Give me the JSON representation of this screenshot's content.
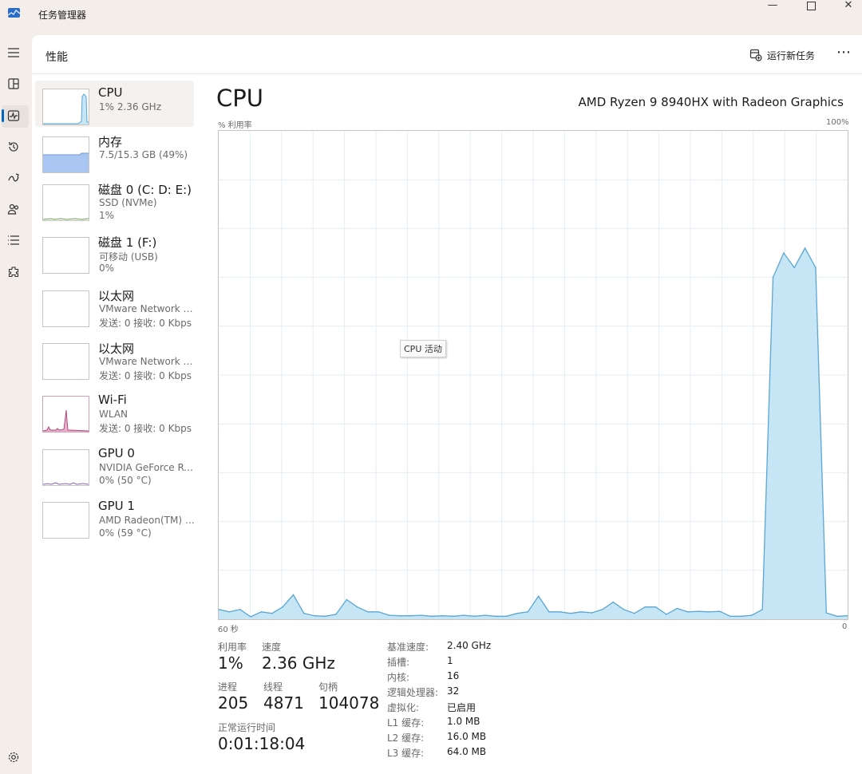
{
  "window": {
    "title": "任务管理器",
    "controls": {
      "minimize": "—",
      "close": "✕"
    }
  },
  "nav_rail": {
    "items": [
      {
        "name": "menu-icon"
      },
      {
        "name": "processes-icon"
      },
      {
        "name": "performance-icon",
        "active": true
      },
      {
        "name": "app-history-icon"
      },
      {
        "name": "startup-apps-icon"
      },
      {
        "name": "users-icon"
      },
      {
        "name": "details-icon"
      },
      {
        "name": "services-icon"
      },
      {
        "name": "settings-icon"
      }
    ]
  },
  "header": {
    "title": "性能",
    "run_new_task": "运行新任务",
    "more": "⋯"
  },
  "sidebar": {
    "items": [
      {
        "name": "CPU",
        "line2": "1%  2.36 GHz",
        "line3": ""
      },
      {
        "name": "内存",
        "line2": "7.5/15.3 GB (49%)",
        "line3": ""
      },
      {
        "name": "磁盘 0 (C: D: E:)",
        "line2": "SSD (NVMe)",
        "line3": "1%"
      },
      {
        "name": "磁盘 1 (F:)",
        "line2": "可移动 (USB)",
        "line3": "0%"
      },
      {
        "name": "以太网",
        "line2": "VMware Network A...",
        "line3": "发送: 0 接收: 0 Kbps"
      },
      {
        "name": "以太网",
        "line2": "VMware Network A...",
        "line3": "发送: 0 接收: 0 Kbps"
      },
      {
        "name": "Wi-Fi",
        "line2": "WLAN",
        "line3": "发送: 0 接收: 0 Kbps"
      },
      {
        "name": "GPU 0",
        "line2": "NVIDIA GeForce RT...",
        "line3": "0%  (50 °C)"
      },
      {
        "name": "GPU 1",
        "line2": "AMD Radeon(TM) 6...",
        "line3": "0%  (59 °C)"
      }
    ]
  },
  "detail": {
    "title": "CPU",
    "model": "AMD Ryzen 9 8940HX with Radeon Graphics",
    "y_label": "% 利用率",
    "y_max_label": "100%",
    "x_left_label": "60 秒",
    "x_right_label": "0",
    "tooltip": "CPU 活动"
  },
  "chart_data": {
    "type": "area",
    "title": "",
    "xlabel": "",
    "ylabel": "% 利用率",
    "ylim": [
      0,
      100
    ],
    "x_range_seconds": [
      60,
      0
    ],
    "grid": true,
    "color": "#5aa7d3",
    "fill": "#c6e6f6",
    "values": [
      2,
      1.5,
      2,
      0.5,
      1.5,
      1.2,
      2.5,
      5,
      1.2,
      0.7,
      0.6,
      1,
      4,
      2.5,
      1.5,
      1.5,
      0.8,
      0.7,
      0.7,
      0.8,
      0.6,
      0.7,
      0.6,
      0.8,
      0.6,
      0.8,
      0.6,
      0.6,
      1.2,
      1.5,
      4.7,
      1.5,
      1.5,
      1.2,
      1.5,
      1.3,
      2,
      3.5,
      2,
      1.2,
      2.5,
      2.5,
      1,
      2.2,
      1.5,
      1.6,
      1.5,
      1.6,
      0.6,
      0.6,
      0.8,
      2,
      70,
      75,
      72,
      76,
      72,
      1.3,
      0.6,
      0.7
    ]
  },
  "stats": {
    "utilization": {
      "label": "利用率",
      "value": "1%"
    },
    "speed": {
      "label": "速度",
      "value": "2.36 GHz"
    },
    "processes": {
      "label": "进程",
      "value": "205"
    },
    "threads": {
      "label": "线程",
      "value": "4871"
    },
    "handles": {
      "label": "句柄",
      "value": "104078"
    },
    "uptime": {
      "label": "正常运行时间",
      "value": "0:01:18:04"
    }
  },
  "specs": [
    {
      "label": "基准速度:",
      "value": "2.40 GHz"
    },
    {
      "label": "插槽:",
      "value": "1"
    },
    {
      "label": "内核:",
      "value": "16"
    },
    {
      "label": "逻辑处理器:",
      "value": "32"
    },
    {
      "label": "虚拟化:",
      "value": "已启用"
    },
    {
      "label": "L1 缓存:",
      "value": "1.0 MB"
    },
    {
      "label": "L2 缓存:",
      "value": "16.0 MB"
    },
    {
      "label": "L3 缓存:",
      "value": "64.0 MB"
    }
  ]
}
